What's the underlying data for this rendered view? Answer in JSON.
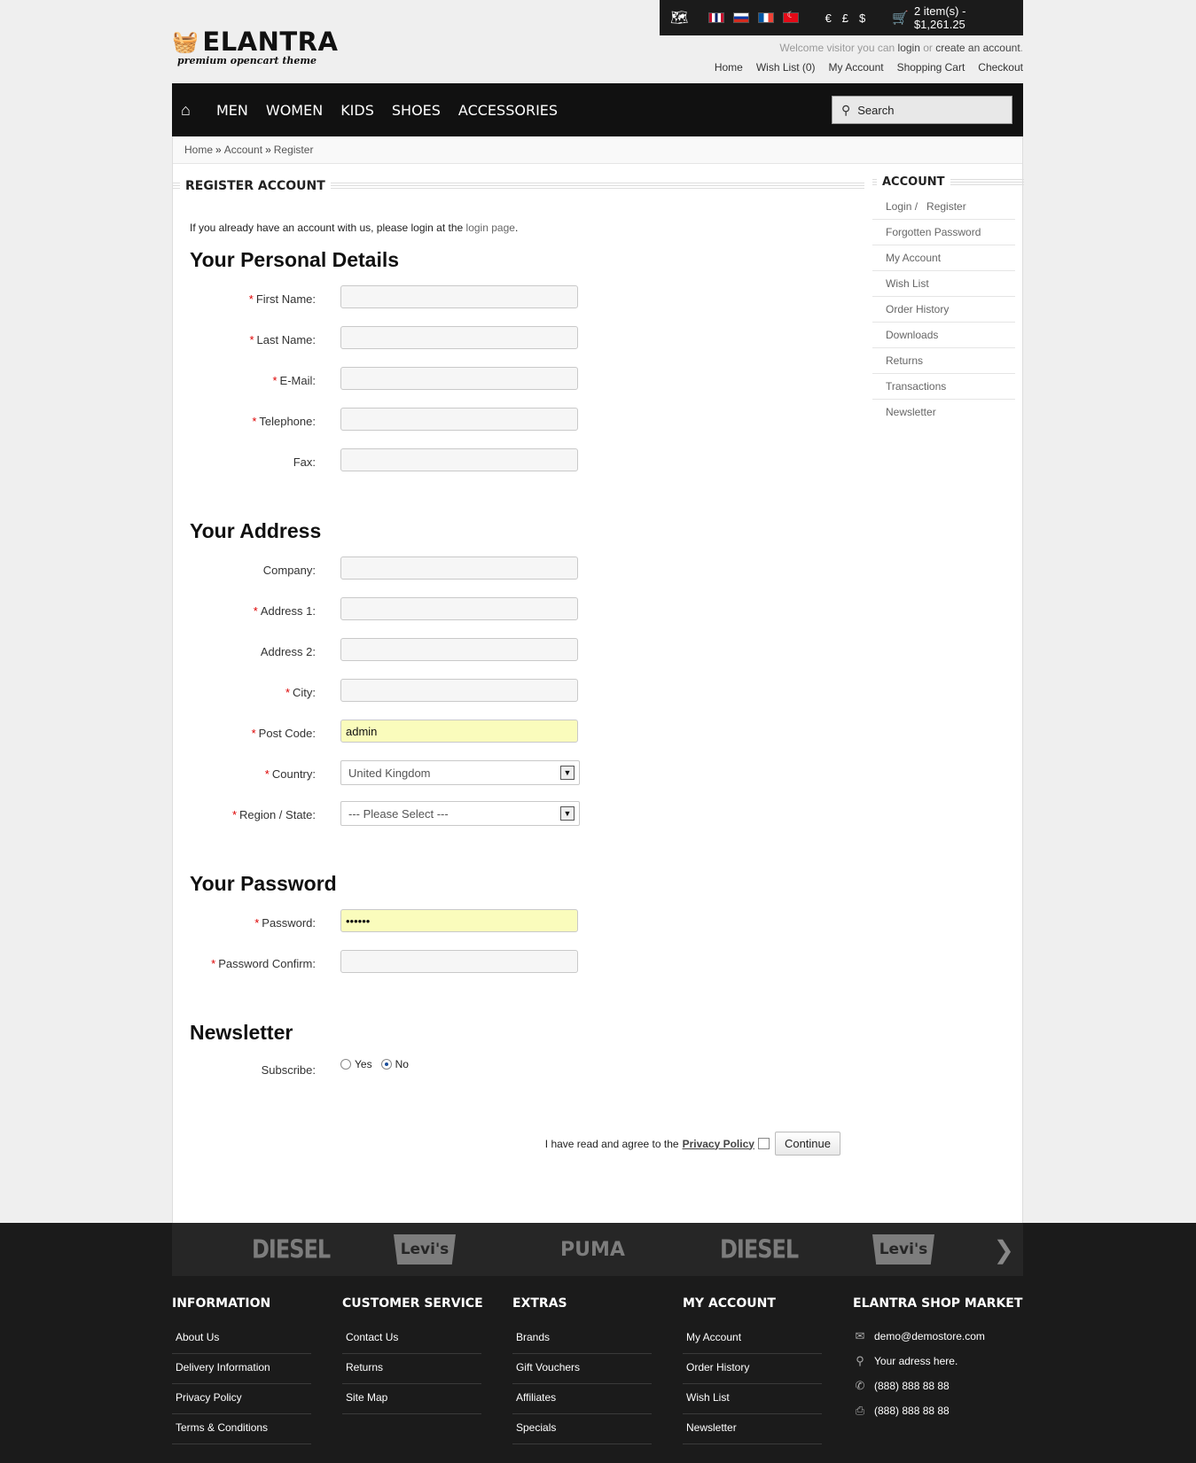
{
  "topbar": {
    "currencies": [
      "€",
      "£",
      "$"
    ],
    "cart": "2 item(s) - $1,261.25"
  },
  "logo": {
    "name": "ELANTRA",
    "tagline": "premium opencart theme"
  },
  "welcome": {
    "prefix": "Welcome visitor you can",
    "login": "login",
    "or": "or",
    "create": "create an account",
    "suffix": "."
  },
  "toplinks": [
    "Home",
    "Wish List (0)",
    "My Account",
    "Shopping Cart",
    "Checkout"
  ],
  "nav": {
    "items": [
      "MEN",
      "WOMEN",
      "KIDS",
      "SHOES",
      "ACCESSORIES"
    ],
    "search_placeholder": "Search"
  },
  "breadcrumb": [
    "Home",
    "Account",
    "Register"
  ],
  "page": {
    "title": "REGISTER ACCOUNT",
    "intro_text": "If you already have an account with us, please login at the",
    "intro_link": "login page",
    "intro_end": "."
  },
  "sections": {
    "personal": "Your Personal Details",
    "address": "Your Address",
    "password": "Your Password",
    "newsletter": "Newsletter"
  },
  "fields": {
    "first_name": {
      "label": "First Name:",
      "value": ""
    },
    "last_name": {
      "label": "Last Name:",
      "value": ""
    },
    "email": {
      "label": "E-Mail:",
      "value": ""
    },
    "telephone": {
      "label": "Telephone:",
      "value": ""
    },
    "fax": {
      "label": "Fax:",
      "value": ""
    },
    "company": {
      "label": "Company:",
      "value": ""
    },
    "address1": {
      "label": "Address 1:",
      "value": ""
    },
    "address2": {
      "label": "Address 2:",
      "value": ""
    },
    "city": {
      "label": "City:",
      "value": ""
    },
    "postcode": {
      "label": "Post Code:",
      "value": "admin"
    },
    "country": {
      "label": "Country:",
      "value": "United Kingdom"
    },
    "region": {
      "label": "Region / State:",
      "value": " --- Please Select --- "
    },
    "password": {
      "label": "Password:",
      "value": "••••••"
    },
    "confirm": {
      "label": "Password Confirm:",
      "value": ""
    },
    "subscribe": {
      "label": "Subscribe:",
      "yes": "Yes",
      "no": "No",
      "selected": "No"
    }
  },
  "agree": {
    "text": "I have read and agree to the",
    "link": "Privacy Policy",
    "button": "Continue"
  },
  "sidebar": {
    "title": "ACCOUNT",
    "login": "Login /",
    "register": "Register",
    "items": [
      "Forgotten Password",
      "My Account",
      "Wish List",
      "Order History",
      "Downloads",
      "Returns",
      "Transactions",
      "Newsletter"
    ]
  },
  "brands": [
    "DIESEL",
    "Levi's",
    "PUMA",
    "DIESEL",
    "Levi's"
  ],
  "footer": {
    "information": {
      "title": "INFORMATION",
      "items": [
        "About Us",
        "Delivery Information",
        "Privacy Policy",
        "Terms & Conditions"
      ]
    },
    "customer_service": {
      "title": "CUSTOMER SERVICE",
      "items": [
        "Contact Us",
        "Returns",
        "Site Map"
      ]
    },
    "extras": {
      "title": "EXTRAS",
      "items": [
        "Brands",
        "Gift Vouchers",
        "Affiliates",
        "Specials"
      ]
    },
    "my_account": {
      "title": "MY ACCOUNT",
      "items": [
        "My Account",
        "Order History",
        "Wish List",
        "Newsletter"
      ]
    },
    "shop": {
      "title": "ELANTRA SHOP MARKET",
      "email": "demo@demostore.com",
      "address": "Your adress here.",
      "phone": "(888) 888 88 88",
      "fax": "(888) 888 88 88"
    }
  }
}
